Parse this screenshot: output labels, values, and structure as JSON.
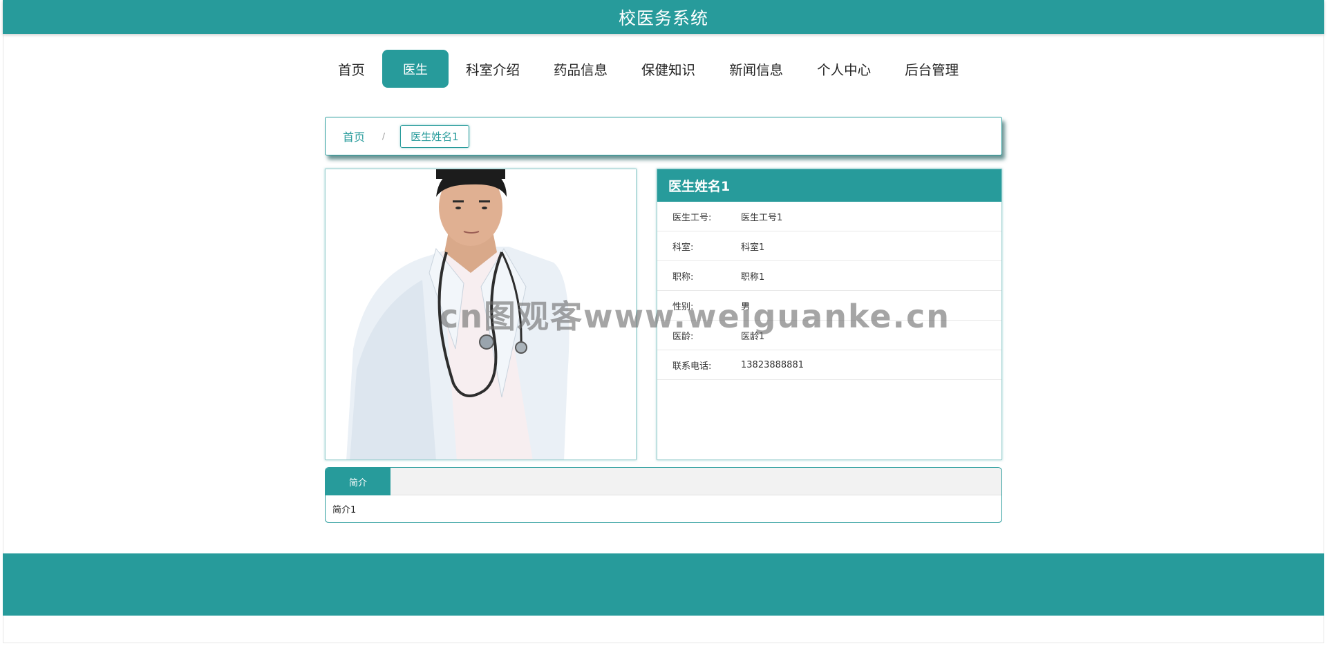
{
  "app": {
    "title": "校医务系统"
  },
  "nav": {
    "items": [
      {
        "label": "首页",
        "active": false
      },
      {
        "label": "医生",
        "active": true
      },
      {
        "label": "科室介绍",
        "active": false
      },
      {
        "label": "药品信息",
        "active": false
      },
      {
        "label": "保健知识",
        "active": false
      },
      {
        "label": "新闻信息",
        "active": false
      },
      {
        "label": "个人中心",
        "active": false
      },
      {
        "label": "后台管理",
        "active": false
      }
    ]
  },
  "breadcrumb": {
    "home": "首页",
    "separator": "/",
    "current": "医生姓名1"
  },
  "doctor": {
    "name": "医生姓名1",
    "fields": [
      {
        "label": "医生工号:",
        "value": "医生工号1"
      },
      {
        "label": "科室:",
        "value": "科室1"
      },
      {
        "label": "职称:",
        "value": "职称1"
      },
      {
        "label": "性别:",
        "value": "男"
      },
      {
        "label": "医龄:",
        "value": "医龄1"
      },
      {
        "label": "联系电话:",
        "value": "13823888881"
      }
    ]
  },
  "intro": {
    "tab_label": "简介",
    "content": "简介1"
  },
  "watermark": "cn图观客www.weiguanke.cn",
  "colors": {
    "primary": "#279b9b",
    "tab_bar": "#f2f2f2"
  }
}
